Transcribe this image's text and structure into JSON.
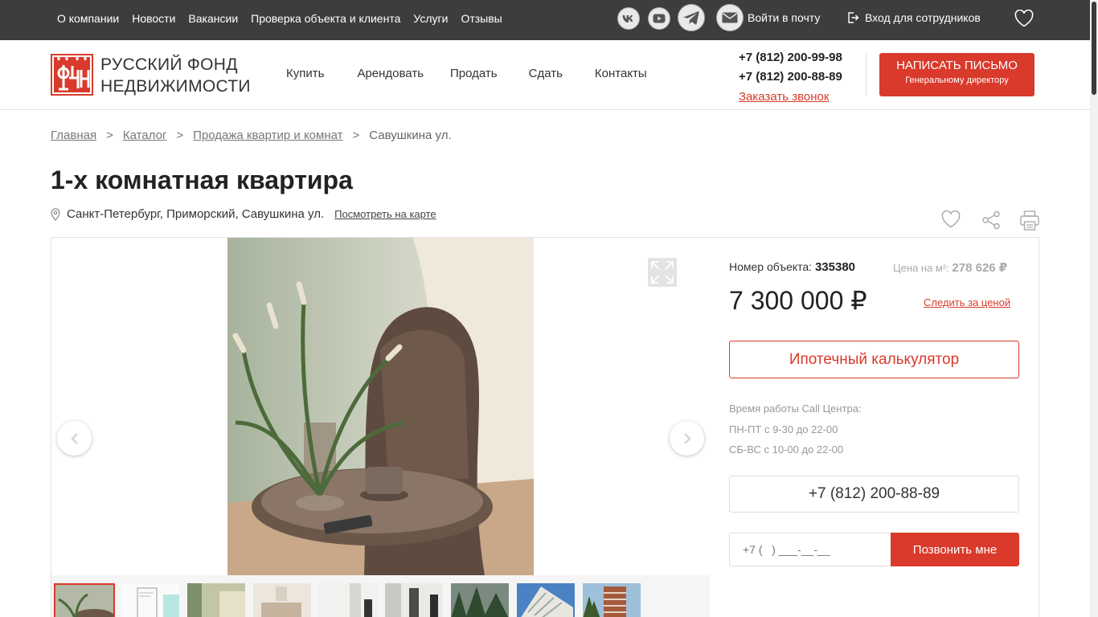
{
  "topbar": {
    "nav": [
      "О компании",
      "Новости",
      "Вакансии",
      "Проверка объекта и клиента",
      "Услуги",
      "Отзывы"
    ],
    "mail_label": "Войти в почту",
    "login_label": "Вход для сотрудников",
    "social": [
      "vk-icon",
      "youtube-icon",
      "telegram-icon",
      "mail-icon"
    ]
  },
  "header": {
    "logo_line1": "Русский фонд",
    "logo_line2": "недвижимости",
    "nav": [
      "Купить",
      "Арендовать",
      "Продать",
      "Сдать",
      "Контакты"
    ],
    "phone1": "+7 (812) 200-99-98",
    "phone2": "+7 (812) 200-88-89",
    "callback": "Заказать звонок",
    "letter_title": "Написать письмо",
    "letter_sub": "Генеральному директору"
  },
  "breadcrumb": [
    "Главная",
    "Каталог",
    "Продажа квартир и комнат",
    "Савушкина ул."
  ],
  "title": "1-х комнатная квартира",
  "address": "Санкт-Петербург, Приморский, Савушкина ул.",
  "map_link": "Посмотреть на карте",
  "listing": {
    "object_label": "Номер объекта:",
    "object_number": "335380",
    "per_m2_label": "Цена на м²:",
    "per_m2_value": "278 626 ₽",
    "price": "7 300 000 ₽",
    "follow_price": "Следить за ценой",
    "mortgage_button": "Ипотечный калькулятор",
    "hours_title": "Время работы Call Центра:",
    "hours_weekday": "ПН-ПТ с 9-30 до 22-00",
    "hours_weekend": "СБ-ВС с 10-00 до 22-00",
    "call_phone": "+7 (812) 200-88-89",
    "phone_placeholder": "+7 (   ) ___-__-__",
    "call_me_button": "Позвонить мне"
  },
  "colors": {
    "brand": "#d93a2b",
    "topbar": "#3d3d3d"
  }
}
